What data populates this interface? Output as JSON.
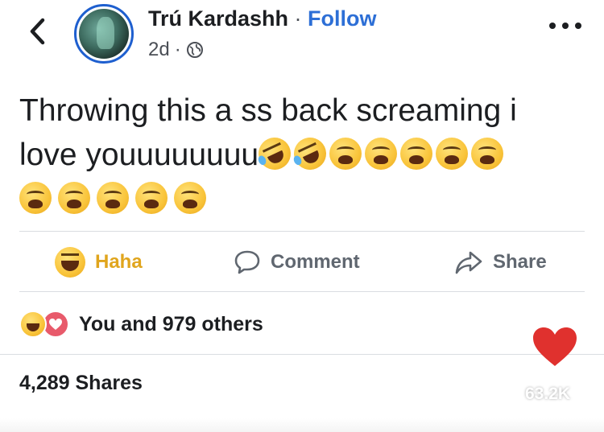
{
  "header": {
    "author_name": "Trú Kardashh",
    "separator": " · ",
    "follow_label": "Follow",
    "timestamp": "2d",
    "meta_separator": "·"
  },
  "post": {
    "text_line1": "Throwing this a ss back screaming i",
    "text_line2": "love youuuuuuuu"
  },
  "actions": {
    "haha_label": "Haha",
    "comment_label": "Comment",
    "share_label": "Share"
  },
  "reactions": {
    "summary": "You and 979 others"
  },
  "shares": {
    "label": "4,289 Shares"
  },
  "overlay": {
    "like_count": "63.2K",
    "heart_color": "#e0312e"
  },
  "colors": {
    "follow_blue": "#2d6fd6",
    "haha_yellow": "#e0a51d",
    "avatar_ring": "#1e5fcf"
  },
  "icons": {
    "back": "chevron-left-icon",
    "more": "more-horizontal-icon",
    "globe": "globe-icon",
    "comment": "comment-bubble-icon",
    "share": "share-arrow-icon",
    "heart": "heart-icon"
  }
}
